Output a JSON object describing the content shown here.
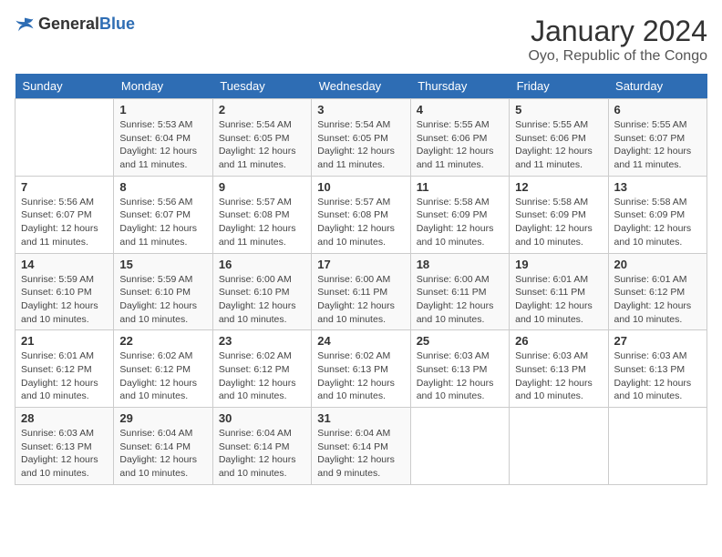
{
  "header": {
    "logo_general": "General",
    "logo_blue": "Blue",
    "main_title": "January 2024",
    "sub_title": "Oyo, Republic of the Congo"
  },
  "days_of_week": [
    "Sunday",
    "Monday",
    "Tuesday",
    "Wednesday",
    "Thursday",
    "Friday",
    "Saturday"
  ],
  "weeks": [
    [
      {
        "day": "",
        "info": ""
      },
      {
        "day": "1",
        "info": "Sunrise: 5:53 AM\nSunset: 6:04 PM\nDaylight: 12 hours and 11 minutes."
      },
      {
        "day": "2",
        "info": "Sunrise: 5:54 AM\nSunset: 6:05 PM\nDaylight: 12 hours and 11 minutes."
      },
      {
        "day": "3",
        "info": "Sunrise: 5:54 AM\nSunset: 6:05 PM\nDaylight: 12 hours and 11 minutes."
      },
      {
        "day": "4",
        "info": "Sunrise: 5:55 AM\nSunset: 6:06 PM\nDaylight: 12 hours and 11 minutes."
      },
      {
        "day": "5",
        "info": "Sunrise: 5:55 AM\nSunset: 6:06 PM\nDaylight: 12 hours and 11 minutes."
      },
      {
        "day": "6",
        "info": "Sunrise: 5:55 AM\nSunset: 6:07 PM\nDaylight: 12 hours and 11 minutes."
      }
    ],
    [
      {
        "day": "7",
        "info": "Sunrise: 5:56 AM\nSunset: 6:07 PM\nDaylight: 12 hours and 11 minutes."
      },
      {
        "day": "8",
        "info": "Sunrise: 5:56 AM\nSunset: 6:07 PM\nDaylight: 12 hours and 11 minutes."
      },
      {
        "day": "9",
        "info": "Sunrise: 5:57 AM\nSunset: 6:08 PM\nDaylight: 12 hours and 11 minutes."
      },
      {
        "day": "10",
        "info": "Sunrise: 5:57 AM\nSunset: 6:08 PM\nDaylight: 12 hours and 10 minutes."
      },
      {
        "day": "11",
        "info": "Sunrise: 5:58 AM\nSunset: 6:09 PM\nDaylight: 12 hours and 10 minutes."
      },
      {
        "day": "12",
        "info": "Sunrise: 5:58 AM\nSunset: 6:09 PM\nDaylight: 12 hours and 10 minutes."
      },
      {
        "day": "13",
        "info": "Sunrise: 5:58 AM\nSunset: 6:09 PM\nDaylight: 12 hours and 10 minutes."
      }
    ],
    [
      {
        "day": "14",
        "info": "Sunrise: 5:59 AM\nSunset: 6:10 PM\nDaylight: 12 hours and 10 minutes."
      },
      {
        "day": "15",
        "info": "Sunrise: 5:59 AM\nSunset: 6:10 PM\nDaylight: 12 hours and 10 minutes."
      },
      {
        "day": "16",
        "info": "Sunrise: 6:00 AM\nSunset: 6:10 PM\nDaylight: 12 hours and 10 minutes."
      },
      {
        "day": "17",
        "info": "Sunrise: 6:00 AM\nSunset: 6:11 PM\nDaylight: 12 hours and 10 minutes."
      },
      {
        "day": "18",
        "info": "Sunrise: 6:00 AM\nSunset: 6:11 PM\nDaylight: 12 hours and 10 minutes."
      },
      {
        "day": "19",
        "info": "Sunrise: 6:01 AM\nSunset: 6:11 PM\nDaylight: 12 hours and 10 minutes."
      },
      {
        "day": "20",
        "info": "Sunrise: 6:01 AM\nSunset: 6:12 PM\nDaylight: 12 hours and 10 minutes."
      }
    ],
    [
      {
        "day": "21",
        "info": "Sunrise: 6:01 AM\nSunset: 6:12 PM\nDaylight: 12 hours and 10 minutes."
      },
      {
        "day": "22",
        "info": "Sunrise: 6:02 AM\nSunset: 6:12 PM\nDaylight: 12 hours and 10 minutes."
      },
      {
        "day": "23",
        "info": "Sunrise: 6:02 AM\nSunset: 6:12 PM\nDaylight: 12 hours and 10 minutes."
      },
      {
        "day": "24",
        "info": "Sunrise: 6:02 AM\nSunset: 6:13 PM\nDaylight: 12 hours and 10 minutes."
      },
      {
        "day": "25",
        "info": "Sunrise: 6:03 AM\nSunset: 6:13 PM\nDaylight: 12 hours and 10 minutes."
      },
      {
        "day": "26",
        "info": "Sunrise: 6:03 AM\nSunset: 6:13 PM\nDaylight: 12 hours and 10 minutes."
      },
      {
        "day": "27",
        "info": "Sunrise: 6:03 AM\nSunset: 6:13 PM\nDaylight: 12 hours and 10 minutes."
      }
    ],
    [
      {
        "day": "28",
        "info": "Sunrise: 6:03 AM\nSunset: 6:13 PM\nDaylight: 12 hours and 10 minutes."
      },
      {
        "day": "29",
        "info": "Sunrise: 6:04 AM\nSunset: 6:14 PM\nDaylight: 12 hours and 10 minutes."
      },
      {
        "day": "30",
        "info": "Sunrise: 6:04 AM\nSunset: 6:14 PM\nDaylight: 12 hours and 10 minutes."
      },
      {
        "day": "31",
        "info": "Sunrise: 6:04 AM\nSunset: 6:14 PM\nDaylight: 12 hours and 9 minutes."
      },
      {
        "day": "",
        "info": ""
      },
      {
        "day": "",
        "info": ""
      },
      {
        "day": "",
        "info": ""
      }
    ]
  ]
}
